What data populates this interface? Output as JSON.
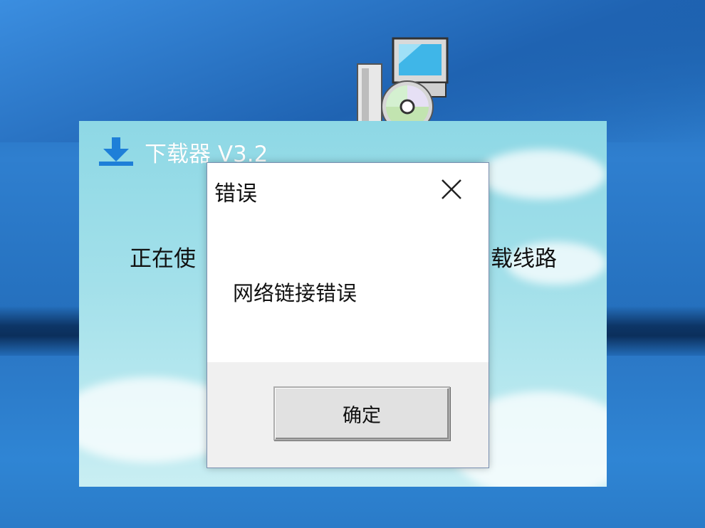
{
  "desktop": {
    "icons": [
      {
        "name": "installer-icon"
      }
    ]
  },
  "app": {
    "title": "下载器 V3.2",
    "status_left": "正在使",
    "status_right": "载线路",
    "icon": "download-icon"
  },
  "dialog": {
    "title": "错误",
    "message": "网络链接错误",
    "ok_label": "确定",
    "close_icon": "close-icon"
  }
}
